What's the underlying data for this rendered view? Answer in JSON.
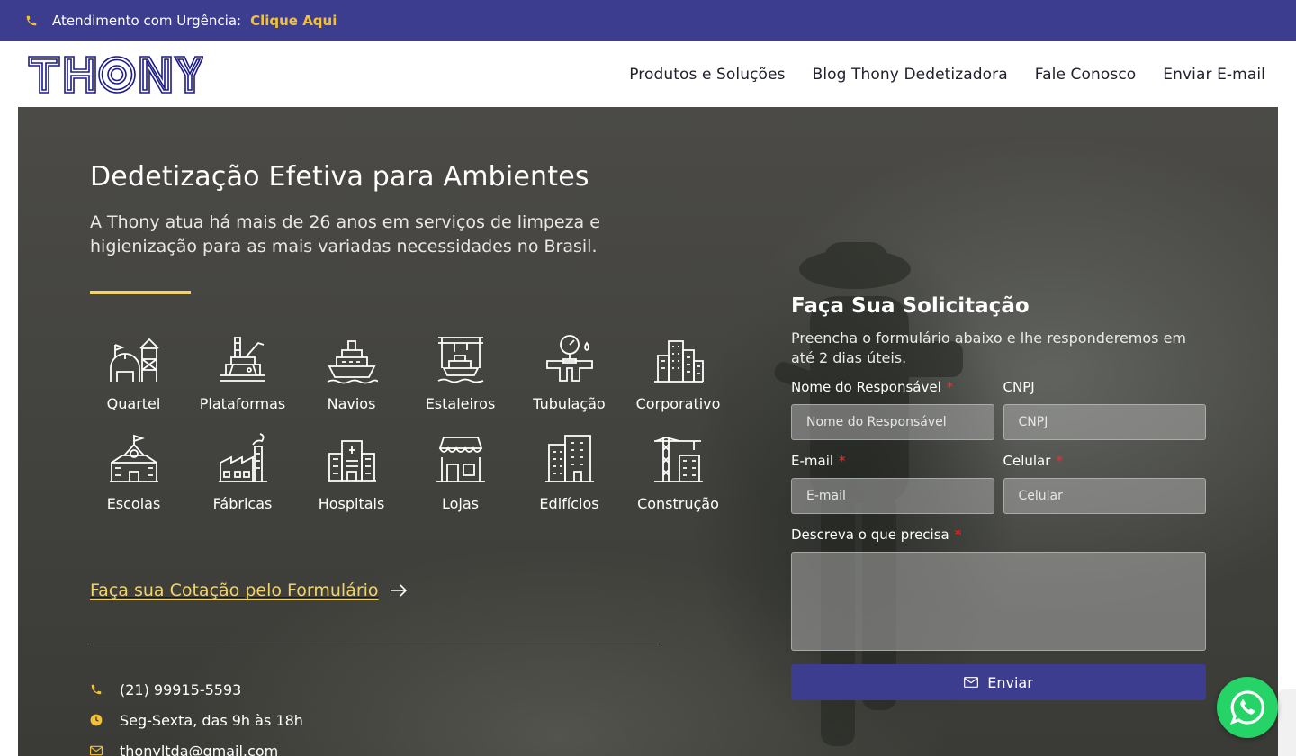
{
  "topbar": {
    "label": "Atendimento com Urgência:",
    "link": "Clique Aqui",
    "icon": "phone-icon"
  },
  "brand": {
    "name": "THONY",
    "color": "#1a1a8a"
  },
  "nav": [
    {
      "label": "Produtos e Soluções"
    },
    {
      "label": "Blog Thony Dedetizadora"
    },
    {
      "label": "Fale Conosco"
    },
    {
      "label": "Enviar E-mail"
    }
  ],
  "hero": {
    "title": "Dedetização Efetiva para Ambientes",
    "subtitle": "A Thony atua há mais de 26 anos em serviços de limpeza e higienização para as mais variadas necessidades no Brasil.",
    "accent_color": "#f2d46b"
  },
  "segments": [
    {
      "label": "Quartel",
      "icon": "barracks-icon"
    },
    {
      "label": "Plataformas",
      "icon": "oil-platform-icon"
    },
    {
      "label": "Navios",
      "icon": "ship-icon"
    },
    {
      "label": "Estaleiros",
      "icon": "shipyard-icon"
    },
    {
      "label": "Tubulação",
      "icon": "pipeline-icon"
    },
    {
      "label": "Corporativo",
      "icon": "corporate-buildings-icon"
    },
    {
      "label": "Escolas",
      "icon": "school-icon"
    },
    {
      "label": "Fábricas",
      "icon": "factory-icon"
    },
    {
      "label": "Hospitais",
      "icon": "hospital-icon"
    },
    {
      "label": "Lojas",
      "icon": "store-icon"
    },
    {
      "label": "Edifícios",
      "icon": "building-icon"
    },
    {
      "label": "Construção",
      "icon": "construction-crane-icon"
    }
  ],
  "cta": {
    "label": "Faça sua Cotação pelo Formulário",
    "icon": "arrow-right-icon"
  },
  "contact": {
    "phone": "(21) 99915-5593",
    "hours": "Seg-Sexta, das 9h às 18h",
    "email": "thonyltda@gmail.com"
  },
  "form": {
    "title": "Faça Sua Solicitação",
    "subtitle": "Preencha o formulário abaixo e lhe responderemos em até 2 dias úteis.",
    "name_label": "Nome do Responsável",
    "name_placeholder": "Nome do Responsável",
    "cnpj_label": "CNPJ",
    "cnpj_placeholder": "CNPJ",
    "email_label": "E-mail",
    "email_placeholder": "E-mail",
    "phone_label": "Celular",
    "phone_placeholder": "Celular",
    "message_label": "Descreva o que precisa",
    "required_mark": "*",
    "submit_label": "Enviar",
    "button_color": "#3d3d8f"
  },
  "whatsapp": {
    "icon": "whatsapp-icon",
    "color": "#25d366"
  }
}
